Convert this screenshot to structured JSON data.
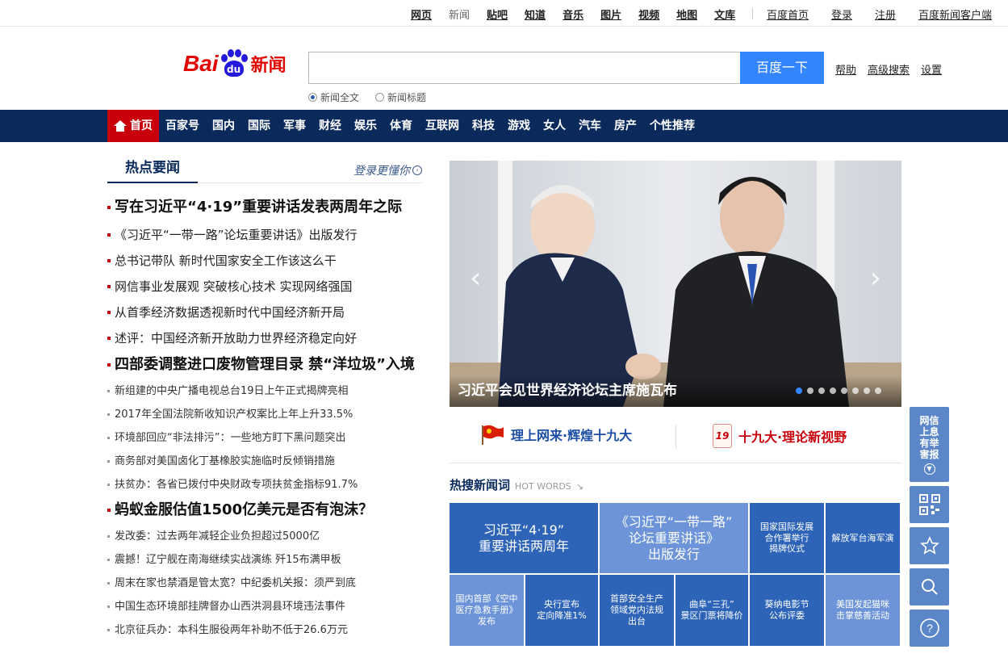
{
  "topnav": {
    "items": [
      "网页",
      "新闻",
      "贴吧",
      "知道",
      "音乐",
      "图片",
      "视频",
      "地图",
      "文库"
    ],
    "right_links": [
      "百度首页",
      "登录",
      "注册",
      "百度新闻客户端"
    ]
  },
  "logo": {
    "bai": "Bai",
    "du": "du",
    "news": "新闻"
  },
  "search": {
    "value": "",
    "button": "百度一下",
    "links": [
      "帮助",
      "高级搜索",
      "设置"
    ],
    "options": [
      "新闻全文",
      "新闻标题"
    ]
  },
  "nav": {
    "items": [
      "首页",
      "百家号",
      "国内",
      "国际",
      "军事",
      "财经",
      "娱乐",
      "体育",
      "互联网",
      "科技",
      "游戏",
      "女人",
      "汽车",
      "房产",
      "个性推荐"
    ]
  },
  "hot_news": {
    "title": "热点要闻",
    "more": "登录更懂你",
    "rows": [
      {
        "t": "写在习近平“4·19”重要讲话发表两周年之际",
        "k": "big"
      },
      {
        "t": "《习近平“一带一路”论坛重要讲话》出版发行",
        "k": "mid"
      },
      {
        "t": "总书记带队 新时代国家安全工作该这么干",
        "k": "mid"
      },
      {
        "t": "网信事业发展观 突破核心技术 实现网络强国",
        "k": "mid"
      },
      {
        "t": "从首季经济数据透视新时代中国经济新开局",
        "k": "mid"
      },
      {
        "t": "述评：中国经济新开放助力世界经济稳定向好",
        "k": "mid"
      },
      {
        "t": "四部委调整进口废物管理目录 禁“洋垃圾”入境",
        "k": "big"
      },
      {
        "t": "新组建的中央广播电视总台19日上午正式揭牌亮相",
        "k": "sm"
      },
      {
        "t": "2017年全国法院新收知识产权案比上年上升33.5%",
        "k": "sm"
      },
      {
        "t": "环境部回应“非法排污”：一些地方盯下黑问题突出",
        "k": "sm"
      },
      {
        "t": "商务部对美国卤化丁基橡胶实施临时反倾销措施",
        "k": "sm"
      },
      {
        "t": "扶贫办：各省已拨付中央财政专项扶贫金指标91.7%",
        "k": "sm"
      },
      {
        "t": "蚂蚁金服估值1500亿美元是否有泡沫？",
        "k": "big"
      },
      {
        "t": "发改委：过去两年减轻企业负担超过5000亿",
        "k": "sm"
      },
      {
        "t": "震撼！辽宁舰在南海继续实战演练 歼15布满甲板",
        "k": "sm"
      },
      {
        "t": "周末在家也禁酒是管太宽？中纪委机关报：须严到底",
        "k": "sm"
      },
      {
        "t": "中国生态环境部挂牌督办山西洪洞县环境违法事件",
        "k": "sm"
      },
      {
        "t": "北京征兵办：本科生服役两年补助不低于26.6万元",
        "k": "sm"
      }
    ]
  },
  "carousel": {
    "caption": "习近平会见世界经济论坛主席施瓦布",
    "slides": 8,
    "active": 0
  },
  "promo": {
    "left": "理上网来·辉煌十九大",
    "right": "十九大·理论新视野",
    "badge": "19"
  },
  "hot_words": {
    "title": "热搜新闻词",
    "subtitle": "HOT WORDS",
    "tiles": [
      "习近平“4·19”\n重要讲话两周年",
      "《习近平“一带一路”\n论坛重要讲话》\n出版发行",
      "国家国际发展\n合作署举行\n揭牌仪式",
      "解放军台海军演",
      "国内首部《空中\n医疗急救手册》\n发布",
      "央行宣布\n定向降准1%",
      "首部安全生产\n领域党内法规\n出台",
      "曲阜“三孔”\n景区门票将降价",
      "葵纳电影节\n公布评委",
      "美国发起猫咪\n击掌慈善活动"
    ]
  },
  "floatbar": {
    "report": "网信上息有举害报"
  },
  "colors": {
    "nav_bg": "#0a2a5c",
    "accent_red": "#c9000b",
    "search_blue": "#3385ff",
    "tile_dark": "#2d64b8",
    "tile_light": "#6d94d8"
  }
}
